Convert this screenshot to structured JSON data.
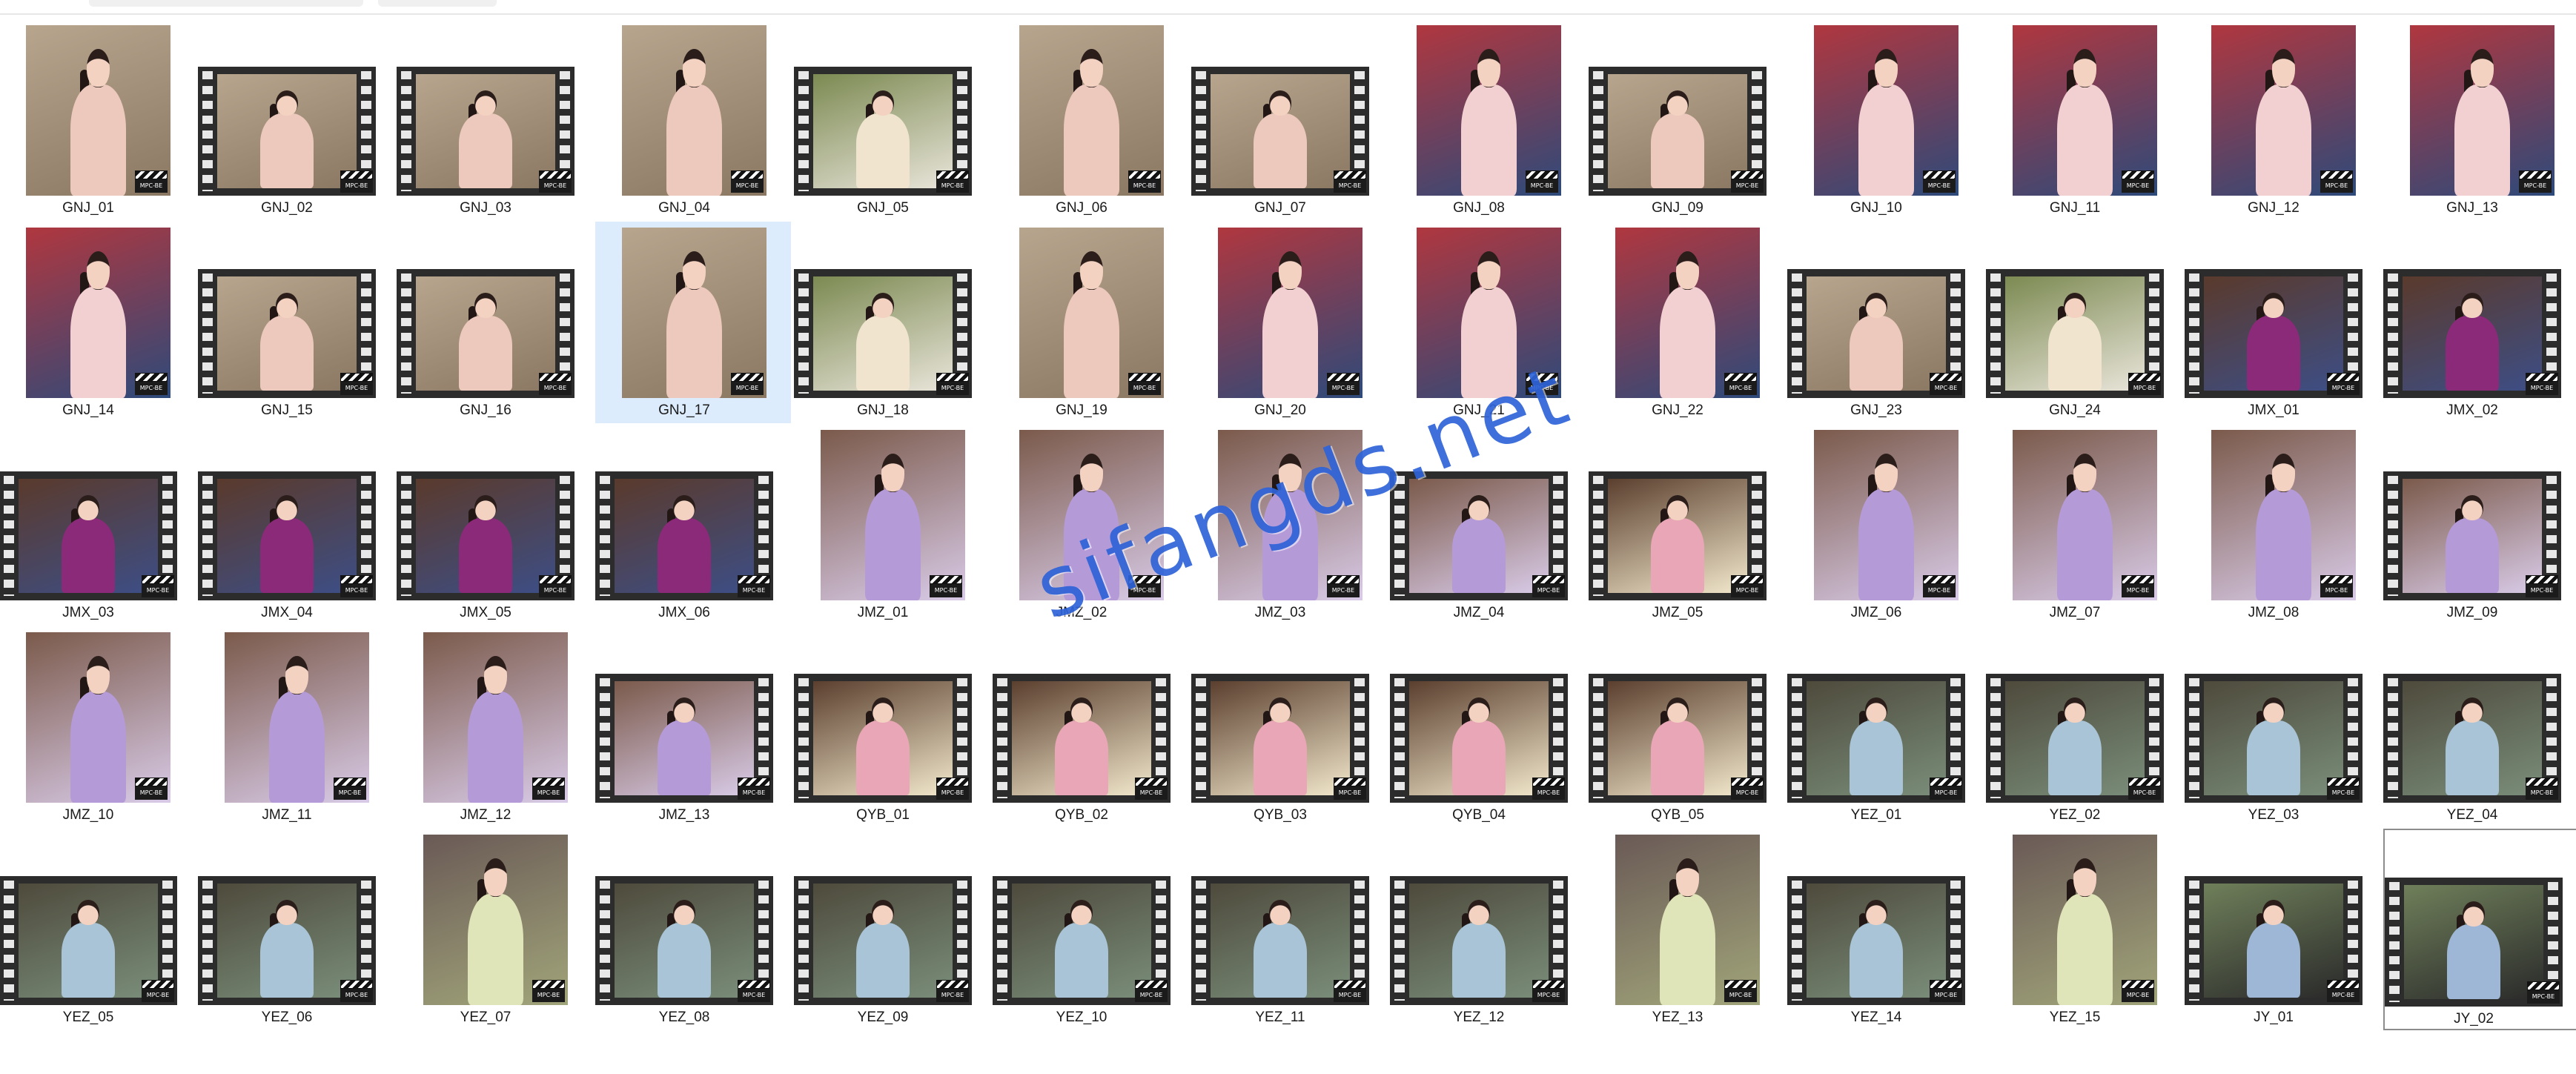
{
  "palette": {
    "GNJ": {
      "bg": "#b7a58e",
      "body": "#edc9bd",
      "accent": "#8a7863"
    },
    "GNJR": {
      "bg": "#b0373f",
      "body": "#f2cfd0",
      "accent": "#2d4a7a"
    },
    "GNJU": {
      "bg": "#7c8a52",
      "body": "#f0e4cf",
      "accent": "#e9e5da"
    },
    "JMX": {
      "bg": "#5a3a2c",
      "body": "#8a2a78",
      "accent": "#3d4e86"
    },
    "JMZ": {
      "bg": "#7b5a4b",
      "body": "#b59ad8",
      "accent": "#d9cbe8"
    },
    "QYB": {
      "bg": "#5b3f2e",
      "body": "#e9a6b6",
      "accent": "#f2e8cc"
    },
    "YEZ": {
      "bg": "#4e4a3c",
      "body": "#a8c4d6",
      "accent": "#7a8e7a"
    },
    "YEZG": {
      "bg": "#6a5a56",
      "body": "#dfe5b8",
      "accent": "#a1a57a"
    },
    "JY": {
      "bg": "#6f7f5a",
      "body": "#9fb7d6",
      "accent": "#2a2a2a"
    }
  },
  "badge_text": "MPC-BE",
  "watermark": "sifangds.net",
  "files": [
    {
      "name": "GNJ_01",
      "style": "portrait",
      "palette": "GNJ"
    },
    {
      "name": "GNJ_02",
      "style": "film",
      "palette": "GNJ"
    },
    {
      "name": "GNJ_03",
      "style": "film",
      "palette": "GNJ"
    },
    {
      "name": "GNJ_04",
      "style": "portrait",
      "palette": "GNJ"
    },
    {
      "name": "GNJ_05",
      "style": "film",
      "palette": "GNJU"
    },
    {
      "name": "GNJ_06",
      "style": "portrait",
      "palette": "GNJ"
    },
    {
      "name": "GNJ_07",
      "style": "film",
      "palette": "GNJ"
    },
    {
      "name": "GNJ_08",
      "style": "portrait",
      "palette": "GNJR"
    },
    {
      "name": "GNJ_09",
      "style": "film",
      "palette": "GNJ"
    },
    {
      "name": "GNJ_10",
      "style": "portrait",
      "palette": "GNJR"
    },
    {
      "name": "GNJ_11",
      "style": "portrait",
      "palette": "GNJR"
    },
    {
      "name": "GNJ_12",
      "style": "portrait",
      "palette": "GNJR"
    },
    {
      "name": "GNJ_13",
      "style": "portrait",
      "palette": "GNJR"
    },
    {
      "name": "GNJ_14",
      "style": "portrait",
      "palette": "GNJR"
    },
    {
      "name": "GNJ_15",
      "style": "film",
      "palette": "GNJ"
    },
    {
      "name": "GNJ_16",
      "style": "film",
      "palette": "GNJ"
    },
    {
      "name": "GNJ_17",
      "style": "portrait",
      "palette": "GNJ",
      "selected": true
    },
    {
      "name": "GNJ_18",
      "style": "film",
      "palette": "GNJU"
    },
    {
      "name": "GNJ_19",
      "style": "portrait",
      "palette": "GNJ"
    },
    {
      "name": "GNJ_20",
      "style": "portrait",
      "palette": "GNJR"
    },
    {
      "name": "GNJ_21",
      "style": "portrait",
      "palette": "GNJR"
    },
    {
      "name": "GNJ_22",
      "style": "portrait",
      "palette": "GNJR"
    },
    {
      "name": "GNJ_23",
      "style": "film",
      "palette": "GNJ"
    },
    {
      "name": "GNJ_24",
      "style": "film",
      "palette": "GNJU"
    },
    {
      "name": "JMX_01",
      "style": "film",
      "palette": "JMX"
    },
    {
      "name": "JMX_02",
      "style": "film",
      "palette": "JMX"
    },
    {
      "name": "JMX_03",
      "style": "film",
      "palette": "JMX"
    },
    {
      "name": "JMX_04",
      "style": "film",
      "palette": "JMX"
    },
    {
      "name": "JMX_05",
      "style": "film",
      "palette": "JMX"
    },
    {
      "name": "JMX_06",
      "style": "film",
      "palette": "JMX"
    },
    {
      "name": "JMZ_01",
      "style": "portrait",
      "palette": "JMZ"
    },
    {
      "name": "JMZ_02",
      "style": "portrait",
      "palette": "JMZ"
    },
    {
      "name": "JMZ_03",
      "style": "portrait",
      "palette": "JMZ"
    },
    {
      "name": "JMZ_04",
      "style": "film",
      "palette": "JMZ"
    },
    {
      "name": "JMZ_05",
      "style": "film",
      "palette": "QYB"
    },
    {
      "name": "JMZ_06",
      "style": "portrait",
      "palette": "JMZ"
    },
    {
      "name": "JMZ_07",
      "style": "portrait",
      "palette": "JMZ"
    },
    {
      "name": "JMZ_08",
      "style": "portrait",
      "palette": "JMZ"
    },
    {
      "name": "JMZ_09",
      "style": "film",
      "palette": "JMZ"
    },
    {
      "name": "JMZ_10",
      "style": "portrait",
      "palette": "JMZ"
    },
    {
      "name": "JMZ_11",
      "style": "portrait",
      "palette": "JMZ"
    },
    {
      "name": "JMZ_12",
      "style": "portrait",
      "palette": "JMZ"
    },
    {
      "name": "JMZ_13",
      "style": "film",
      "palette": "JMZ"
    },
    {
      "name": "QYB_01",
      "style": "film",
      "palette": "QYB"
    },
    {
      "name": "QYB_02",
      "style": "film",
      "palette": "QYB"
    },
    {
      "name": "QYB_03",
      "style": "film",
      "palette": "QYB"
    },
    {
      "name": "QYB_04",
      "style": "film",
      "palette": "QYB"
    },
    {
      "name": "QYB_05",
      "style": "film",
      "palette": "QYB"
    },
    {
      "name": "YEZ_01",
      "style": "film",
      "palette": "YEZ"
    },
    {
      "name": "YEZ_02",
      "style": "film",
      "palette": "YEZ"
    },
    {
      "name": "YEZ_03",
      "style": "film",
      "palette": "YEZ"
    },
    {
      "name": "YEZ_04",
      "style": "film",
      "palette": "YEZ"
    },
    {
      "name": "YEZ_05",
      "style": "film",
      "palette": "YEZ"
    },
    {
      "name": "YEZ_06",
      "style": "film",
      "palette": "YEZ"
    },
    {
      "name": "YEZ_07",
      "style": "portrait",
      "palette": "YEZG"
    },
    {
      "name": "YEZ_08",
      "style": "film",
      "palette": "YEZ"
    },
    {
      "name": "YEZ_09",
      "style": "film",
      "palette": "YEZ"
    },
    {
      "name": "YEZ_10",
      "style": "film",
      "palette": "YEZ"
    },
    {
      "name": "YEZ_11",
      "style": "film",
      "palette": "YEZ"
    },
    {
      "name": "YEZ_12",
      "style": "film",
      "palette": "YEZ"
    },
    {
      "name": "YEZ_13",
      "style": "portrait",
      "palette": "YEZG"
    },
    {
      "name": "YEZ_14",
      "style": "film",
      "palette": "YEZ"
    },
    {
      "name": "YEZ_15",
      "style": "portrait",
      "palette": "YEZG"
    },
    {
      "name": "JY_01",
      "style": "film",
      "palette": "JY"
    },
    {
      "name": "JY_02",
      "style": "film",
      "palette": "JY",
      "focused": true
    }
  ]
}
